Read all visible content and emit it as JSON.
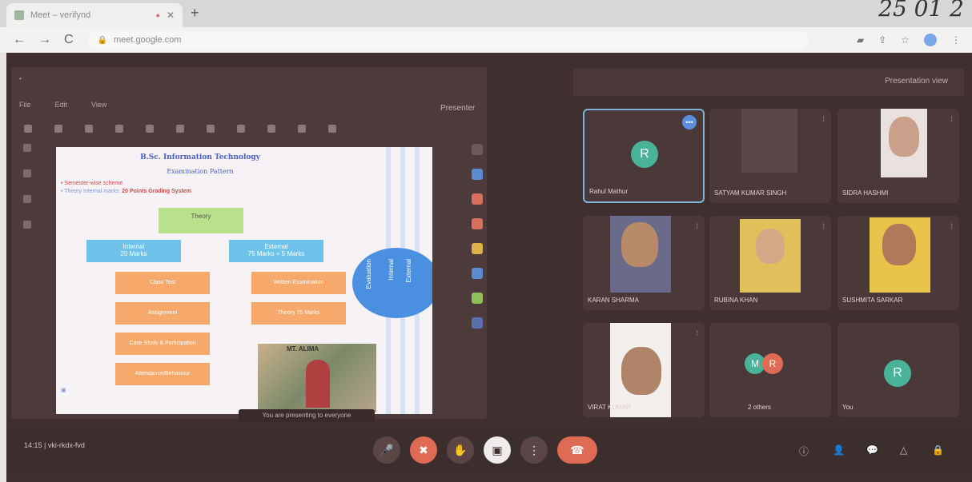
{
  "browser": {
    "tab_title": "Meet – verifynd",
    "tab_indicator": "●",
    "tab_close": "✕",
    "new_tab": "+",
    "url": "meet.google.com",
    "back": "←",
    "forward": "→",
    "reload": "C",
    "handwritten_date": "25 01 2"
  },
  "header": {
    "present_label": "Presentation view"
  },
  "presentation": {
    "presenter_label": "Presenter",
    "menu": [
      "File",
      "Edit",
      "View"
    ],
    "slide": {
      "title": "B.Sc. Information Technology",
      "subtitle": "Examination Pattern",
      "line1": "• Semester-wise scheme",
      "line2_prefix": "• Theory Internal marks:",
      "line2_highlight": "20 Points Grading System",
      "green_box": "Theory",
      "blue_box_1_top": "Internal",
      "blue_box_1": "20 Marks",
      "blue_box_2_top": "External",
      "blue_box_2": "75 Marks + 5 Marks",
      "orange_left": [
        "Class Test",
        "Assignment",
        "Case Study & Participation",
        "Attendance/Behaviour"
      ],
      "orange_right": [
        "Written Examination",
        "Theory 75 Marks"
      ],
      "vertical_1": "Evaluation",
      "vertical_2": "Internal",
      "vertical_3": "External",
      "photo_banner": "MT. ALIMA"
    },
    "caption": "You are presenting to everyone"
  },
  "participants": [
    {
      "name": "Rahul Mathur",
      "initial": "R",
      "active": true
    },
    {
      "name": "SATYAM KUMAR SINGH"
    },
    {
      "name": "SIDRA HASHMI"
    },
    {
      "name": "KARAN SHARMA"
    },
    {
      "name": "RUBINA KHAN"
    },
    {
      "name": "SUSHMITA SARKAR"
    },
    {
      "name": "VIRAT KUMAR"
    },
    {
      "name": "2 others",
      "initials": [
        "M",
        "R"
      ]
    },
    {
      "name": "You",
      "initial": "R"
    }
  ],
  "bottom": {
    "meeting_info": "14:15 | vki-rkdx-fvd",
    "mic": "🎤",
    "camera": "✖",
    "hand": "✋",
    "present": "▣",
    "more": "⋮",
    "leave": "☎",
    "info": "ⓘ",
    "people": "👤",
    "chat": "💬",
    "activities": "△",
    "lock": "🔒"
  }
}
